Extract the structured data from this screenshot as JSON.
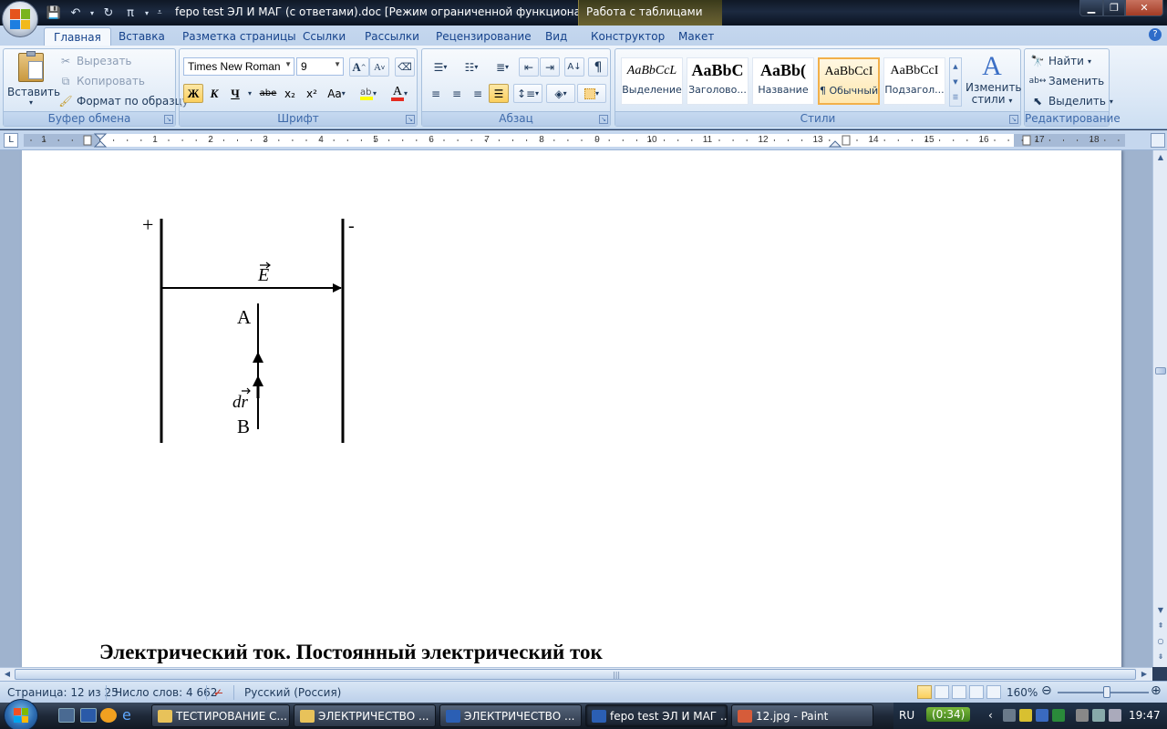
{
  "window": {
    "title": "fepo test ЭЛ И МАГ (с ответами).doc [Режим ограниченной функционально...",
    "context_title": "Работа с таблицами"
  },
  "tabs": [
    "Главная",
    "Вставка",
    "Разметка страницы",
    "Ссылки",
    "Рассылки",
    "Рецензирование",
    "Вид",
    "Конструктор",
    "Макет"
  ],
  "clipboard": {
    "paste": "Вставить",
    "cut": "Вырезать",
    "copy": "Копировать",
    "format_painter": "Формат по образцу",
    "label": "Буфер обмена"
  },
  "font": {
    "name": "Times New Roman",
    "size": "9",
    "label": "Шрифт",
    "bold": "Ж",
    "italic": "К",
    "underline": "Ч",
    "strike": "abe",
    "sub": "x₂",
    "sup": "x²",
    "case": "Aa",
    "grow": "A",
    "shrink": "A"
  },
  "paragraph": {
    "label": "Абзац"
  },
  "styles": {
    "label": "Стили",
    "items": [
      {
        "sample": "AaBbCcL",
        "name": "Выделение"
      },
      {
        "sample": "AaBbC",
        "name": "Заголово..."
      },
      {
        "sample": "AaBb(",
        "name": "Название"
      },
      {
        "sample": "AaBbCcI",
        "name": "¶ Обычный"
      },
      {
        "sample": "AaBbCcI",
        "name": "Подзагол..."
      }
    ],
    "change_line1": "Изменить",
    "change_line2": "стили"
  },
  "editing": {
    "label": "Редактирование",
    "find": "Найти",
    "replace": "Заменить",
    "select": "Выделить"
  },
  "ruler": {
    "tab_marker": "L",
    "numbers": [
      "1",
      "1",
      "2",
      "3",
      "4",
      "5",
      "6",
      "7",
      "8",
      "9",
      "10",
      "11",
      "12",
      "13",
      "14",
      "15",
      "16",
      "17",
      "18"
    ]
  },
  "figure": {
    "plus": "+",
    "minus": "-",
    "field": "E",
    "point_a": "A",
    "point_b": "B",
    "dr": "dr"
  },
  "document": {
    "heading": "Электрический ток. Постоянный электрический ток"
  },
  "status": {
    "page": "Страница: 12 из 25",
    "words": "Число слов: 4 662",
    "language": "Русский (Россия)",
    "zoom": "160%"
  },
  "taskbar": {
    "buttons": [
      {
        "label": "ТЕСТИРОВАНИЕ С..."
      },
      {
        "label": "ЭЛЕКТРИЧЕСТВО ..."
      },
      {
        "label": "ЭЛЕКТРИЧЕСТВО ..."
      },
      {
        "label": "fepo test ЭЛ И МАГ ..."
      },
      {
        "label": "12.jpg - Paint"
      }
    ],
    "lang": "RU",
    "timer": "(0:34)",
    "clock": "19:47"
  }
}
